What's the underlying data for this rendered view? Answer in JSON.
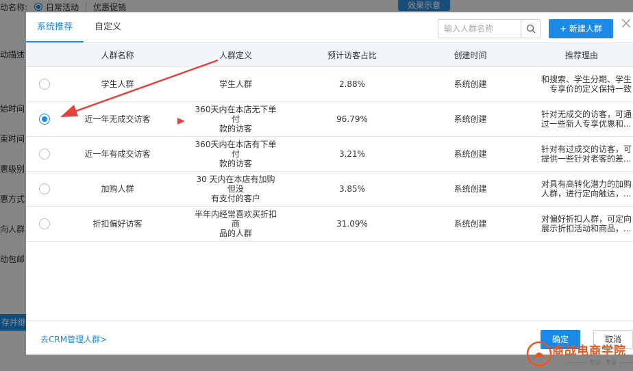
{
  "background": {
    "top_label": "动名称:",
    "radio_daily": "日常活动",
    "option_promo": "优惠促销",
    "effect_button": "效果示意",
    "side_labels": [
      {
        "text": "动描述"
      },
      {
        "text": "始时间"
      },
      {
        "text": "束时间"
      },
      {
        "text": "惠级别"
      },
      {
        "text": "惠方式"
      },
      {
        "text": "向人群"
      },
      {
        "text": "动包邮"
      }
    ],
    "save_button": "存并继续"
  },
  "modal": {
    "tabs": [
      {
        "label": "系统推荐",
        "active": true
      },
      {
        "label": "自定义",
        "active": false
      }
    ],
    "search": {
      "placeholder": "输入人群名称",
      "value": ""
    },
    "new_button": "+ 新建人群",
    "columns": [
      "人群名称",
      "人群定义",
      "预计访客占比",
      "创建时间",
      "推荐理由"
    ],
    "rows": [
      {
        "selected": false,
        "name": "学生人群",
        "def1": "学生人群",
        "def2": "",
        "ratio": "2.88%",
        "created": "系统创建",
        "reason1": "和搜索、学生分期、学生",
        "reason2": "专享价的定义保持一致"
      },
      {
        "selected": true,
        "name": "近一年无成交访客",
        "def1": "360天内在本店无下单付",
        "def2": "款的访客",
        "ratio": "96.79%",
        "created": "系统创建",
        "reason1": "针对无成交的访客，可通",
        "reason2": "过一些新人专享优惠和..."
      },
      {
        "selected": false,
        "name": "近一年有成交访客",
        "def1": "360天内在本店有下单付",
        "def2": "款的访客",
        "ratio": "3.21%",
        "created": "系统创建",
        "reason1": "针对有过成交的访客，可",
        "reason2": "提供一些针对老客的差..."
      },
      {
        "selected": false,
        "name": "加购人群",
        "def1": "30 天内在本店有加购但没",
        "def2": "有支付的客户",
        "ratio": "3.85%",
        "created": "系统创建",
        "reason1": "对具有高转化潜力的加购",
        "reason2": "人群，进行定向触达，..."
      },
      {
        "selected": false,
        "name": "折扣偏好访客",
        "def1": "半年内经常喜欢买折扣商",
        "def2": "品的人群",
        "ratio": "31.09%",
        "created": "系统创建",
        "reason1": "对偏好折扣人群，可定向",
        "reason2": "展示折扣活动和商品，..."
      }
    ],
    "crm_link": "去CRM管理人群>",
    "ok_button": "确定",
    "cancel_button": "取消"
  },
  "annotation_color": "#e84040",
  "accent_color": "#1a8ae6"
}
